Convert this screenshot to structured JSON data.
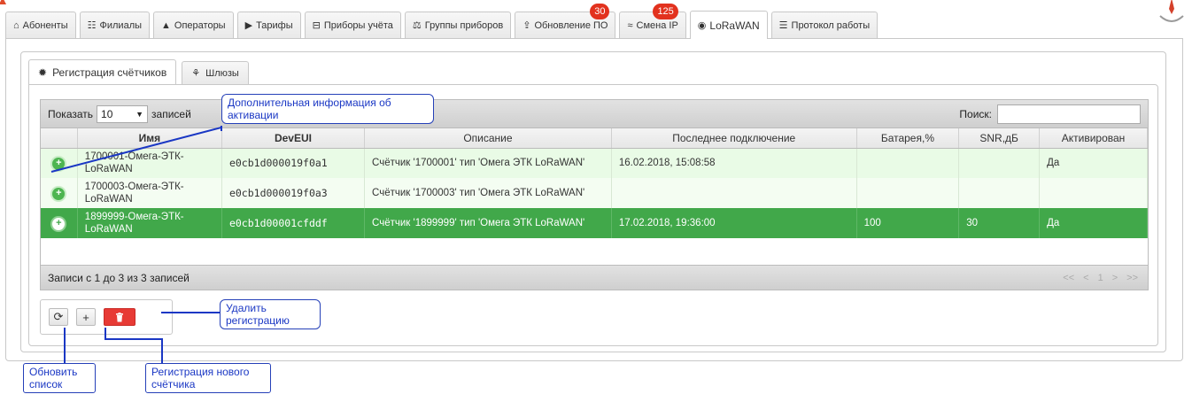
{
  "top_tabs": [
    {
      "icon": "home-icon",
      "glyph": "⌂",
      "label": "Абоненты"
    },
    {
      "icon": "sitemap-icon",
      "glyph": "☷",
      "label": "Филиалы"
    },
    {
      "icon": "user-icon",
      "glyph": "▲",
      "label": "Операторы"
    },
    {
      "icon": "tag-icon",
      "glyph": "▶",
      "label": "Тарифы"
    },
    {
      "icon": "meter-icon",
      "glyph": "⊟",
      "label": "Приборы учёта"
    },
    {
      "icon": "scale-icon",
      "glyph": "⚖",
      "label": "Группы приборов"
    },
    {
      "icon": "upload-icon",
      "glyph": "⇪",
      "label": "Обновление ПО",
      "badge": "30"
    },
    {
      "icon": "rss-icon",
      "glyph": "≈",
      "label": "Смена IP",
      "badge": "125"
    },
    {
      "icon": "pin-icon",
      "glyph": "◉",
      "label": "LoRaWAN",
      "active": true
    },
    {
      "icon": "list-icon",
      "glyph": "☰",
      "label": "Протокол работы"
    }
  ],
  "sub_tabs": [
    {
      "icon": "gear-icon",
      "glyph": "✹",
      "label": "Регистрация счётчиков",
      "active": true
    },
    {
      "icon": "cogs-icon",
      "glyph": "⚘",
      "label": "Шлюзы"
    }
  ],
  "table": {
    "show_label": "Показать",
    "length_value": "10",
    "records_label": "записей",
    "search_label": "Поиск:",
    "search_value": "",
    "columns": [
      "Имя",
      "DevEUI",
      "Описание",
      "Последнее подключение",
      "Батарея,%",
      "SNR,дБ",
      "Активирован"
    ],
    "rows": [
      {
        "name": "1700001-Омега-ЭТК-LoRaWAN",
        "deveui": "e0cb1d000019f0a1",
        "description": "Счётчик '1700001' тип 'Омега ЭТК LoRaWAN'",
        "last_connection": "16.02.2018, 15:08:58",
        "battery": "",
        "snr": "",
        "activated": "Да"
      },
      {
        "name": "1700003-Омега-ЭТК-LoRaWAN",
        "deveui": "e0cb1d000019f0a3",
        "description": "Счётчик '1700003' тип 'Омега ЭТК LoRaWAN'",
        "last_connection": "",
        "battery": "",
        "snr": "",
        "activated": ""
      },
      {
        "name": "1899999-Омега-ЭТК-LoRaWAN",
        "deveui": "e0cb1d00001cfddf",
        "description": "Счётчик '1899999' тип 'Омега ЭТК LoRaWAN'",
        "last_connection": "17.02.2018, 19:36:00",
        "battery": "100",
        "snr": "30",
        "activated": "Да"
      }
    ],
    "info": "Записи с 1 до 3 из 3 записей",
    "pager": [
      "<<",
      "<",
      "1",
      ">",
      ">>"
    ]
  },
  "toolbar": {
    "refresh_icon": "refresh-icon",
    "add_icon": "plus-icon",
    "delete_icon": "trash-icon"
  },
  "callouts": {
    "extra_info": "Дополнительная информация об активации",
    "delete": "Удалить регистрацию",
    "refresh": "Обновить список",
    "register": "Регистрация нового счётчика"
  },
  "colors": {
    "accent_green": "#41a84a",
    "badge_red": "#e2321e",
    "delete_red": "#e73a35",
    "callout_blue": "#1a37c4"
  }
}
